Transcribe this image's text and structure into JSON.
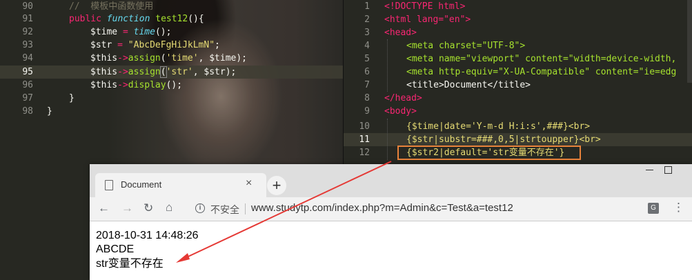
{
  "left_editor": {
    "lines": [
      {
        "n": "90",
        "comment": "//  模板中函数使用"
      },
      {
        "n": "91",
        "kw": "public",
        "fkw": "function",
        "name": "test12",
        "rest": "(){"
      },
      {
        "n": "92",
        "var": "$time",
        "op": " = ",
        "call": "time",
        "rest": "();"
      },
      {
        "n": "93",
        "var": "$str",
        "op": " = ",
        "str": "\"AbcDeFgHiJkLmN\"",
        "rest": ";"
      },
      {
        "n": "94",
        "var": "$this",
        "arr": "->",
        "call": "assign",
        "p1": "(",
        "s1": "'time'",
        "p2": ", ",
        "v2": "$time",
        "p3": ");"
      },
      {
        "n": "95",
        "var": "$this",
        "arr": "->",
        "call": "assign",
        "p1": "(",
        "s1": "'str'",
        "p2": ", ",
        "v2": "$str",
        "p3": ");"
      },
      {
        "n": "96",
        "var": "$this",
        "arr": "->",
        "call": "display",
        "rest": "();"
      },
      {
        "n": "97",
        "rest": "}"
      },
      {
        "n": "98",
        "rest": "}"
      }
    ]
  },
  "right_editor": {
    "lines": [
      {
        "n": "1",
        "text": "<!DOCTYPE html>"
      },
      {
        "n": "2",
        "text": "<html lang=\"en\">"
      },
      {
        "n": "3",
        "text": "<head>"
      },
      {
        "n": "4",
        "text": "<meta charset=\"UTF-8\">"
      },
      {
        "n": "5",
        "text": "<meta name=\"viewport\" content=\"width=device-width,"
      },
      {
        "n": "6",
        "text": "<meta http-equiv=\"X-UA-Compatible\" content=\"ie=edg"
      },
      {
        "n": "7",
        "text": "<title>Document</title>"
      },
      {
        "n": "8",
        "text": "</head>"
      },
      {
        "n": "9",
        "text": "<body>"
      },
      {
        "n": "10",
        "text": "{$time|date='Y-m-d H:i:s',###}<br>"
      },
      {
        "n": "11",
        "text": "{$str|substr=###,0,5|strtoupper}<br>"
      },
      {
        "n": "12",
        "text": "{$str2|default='str变量不存在'}"
      }
    ]
  },
  "browser": {
    "tab_title": "Document",
    "new_tab_label": "+",
    "security_label": "不安全",
    "url": "www.studytp.com/index.php?m=Admin&c=Test&a=test12",
    "output": [
      "2018-10-31 14:48:26",
      "ABCDE",
      "str变量不存在"
    ]
  },
  "colors": {
    "highlight_box": "#e8823b",
    "arrow": "#e53935"
  },
  "icons": [
    "page-icon",
    "close-icon",
    "back-icon",
    "forward-icon",
    "reload-icon",
    "home-icon",
    "info-icon",
    "translate-icon",
    "menu-icon",
    "minimize-icon",
    "maximize-icon"
  ]
}
